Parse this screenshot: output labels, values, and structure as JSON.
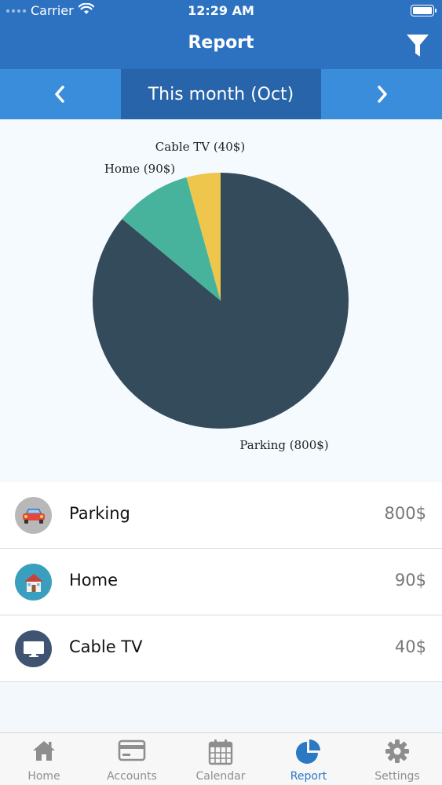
{
  "status_bar": {
    "carrier": "Carrier",
    "time": "12:29 AM"
  },
  "header": {
    "title": "Report",
    "filter_icon": "filter-icon"
  },
  "month_selector": {
    "label": "This month (Oct)",
    "prev_icon": "chevron-left-icon",
    "next_icon": "chevron-right-icon"
  },
  "chart_data": {
    "type": "pie",
    "slices": [
      {
        "name": "Parking",
        "value": 800,
        "label": "Parking (800$)",
        "color": "#344b5c"
      },
      {
        "name": "Home",
        "value": 90,
        "label": "Home (90$)",
        "color": "#48b39c"
      },
      {
        "name": "Cable TV",
        "value": 40,
        "label": "Cable TV (40$)",
        "color": "#edc64b"
      }
    ]
  },
  "list": [
    {
      "name": "Parking",
      "amount": "800$",
      "icon": "car-icon",
      "icon_bg": "#b8b8b8"
    },
    {
      "name": "Home",
      "amount": "90$",
      "icon": "house-icon",
      "icon_bg": "#3a9fbf"
    },
    {
      "name": "Cable TV",
      "amount": "40$",
      "icon": "tv-icon",
      "icon_bg": "#3e5470"
    }
  ],
  "tabs": [
    {
      "label": "Home",
      "icon": "home-icon",
      "active": false
    },
    {
      "label": "Accounts",
      "icon": "credit-card-icon",
      "active": false
    },
    {
      "label": "Calendar",
      "icon": "calendar-icon",
      "active": false
    },
    {
      "label": "Report",
      "icon": "pie-chart-icon",
      "active": true
    },
    {
      "label": "Settings",
      "icon": "gear-icon",
      "active": false
    }
  ],
  "colors": {
    "header": "#2d72c1",
    "month_bar": "#3a8ddb",
    "month_active": "#2864a9",
    "accent": "#2c78c2"
  }
}
